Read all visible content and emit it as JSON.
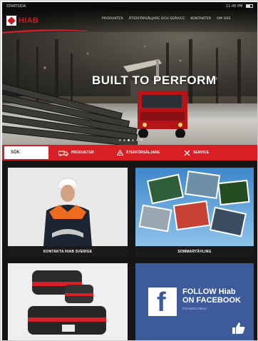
{
  "statusbar": {
    "carrier": "STARTSIDA",
    "right": "11:45 PM"
  },
  "header": {
    "logo_text": "HIAB",
    "nav": [
      {
        "label": "PRODUKTER"
      },
      {
        "label": "ÅTERFÖRSÄLJARE OCH SERVICE"
      },
      {
        "label": "KONTAKTER"
      },
      {
        "label": "OM OSS"
      }
    ]
  },
  "hero": {
    "title": "BUILT TO PERFORM",
    "slides": 6,
    "active_slide": 2
  },
  "actionbar": {
    "search_label": "SÖK",
    "buttons": [
      {
        "label": "PRODUKTER",
        "icon": "truck-icon"
      },
      {
        "label": "ÅTERFÖRSÄLJARE",
        "icon": "dealer-icon"
      },
      {
        "label": "SERVICE",
        "icon": "wrench-icon"
      }
    ]
  },
  "tiles": [
    {
      "caption": "KONTAKTA HIAB SVERIGE"
    },
    {
      "caption": "SOMMARTÄVLING"
    },
    {
      "caption": ""
    },
    {
      "caption": ""
    }
  ],
  "facebook": {
    "title_line1": "FOLLOW Hiab",
    "title_line2": "ON FACEBOOK",
    "subtitle": "#HIABGLOBAL",
    "logo_letter": "f"
  },
  "colors": {
    "brand_red": "#d81f26",
    "facebook_blue": "#3d5a9a"
  }
}
